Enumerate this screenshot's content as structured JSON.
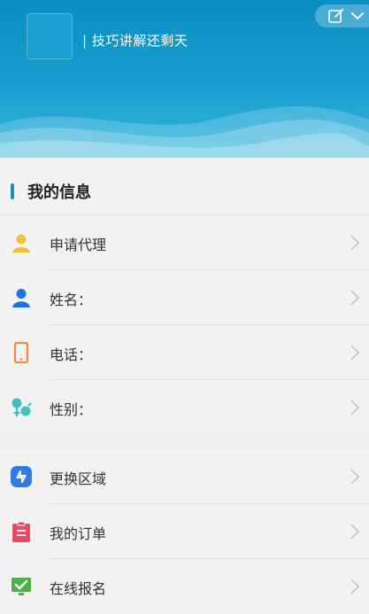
{
  "header": {
    "tagline": "| 技巧讲解还剩天"
  },
  "section": {
    "title": "我的信息"
  },
  "group1": [
    {
      "label": "申请代理",
      "icon": "agent-person-icon",
      "color": "#f1c232"
    },
    {
      "label": "姓名：",
      "icon": "person-icon",
      "color": "#1a73e8"
    },
    {
      "label": "电话：",
      "icon": "phone-icon",
      "color": "#f08a3c"
    },
    {
      "label": "性别：",
      "icon": "gender-icon",
      "color": "#3cc3c0"
    }
  ],
  "group2": [
    {
      "label": "更换区域",
      "icon": "swap-region-icon",
      "color": "#2d7be8"
    },
    {
      "label": "我的订单",
      "icon": "order-clipboard-icon",
      "color": "#e84a5f"
    },
    {
      "label": "在线报名",
      "icon": "online-signup-icon",
      "color": "#49b34a"
    }
  ]
}
